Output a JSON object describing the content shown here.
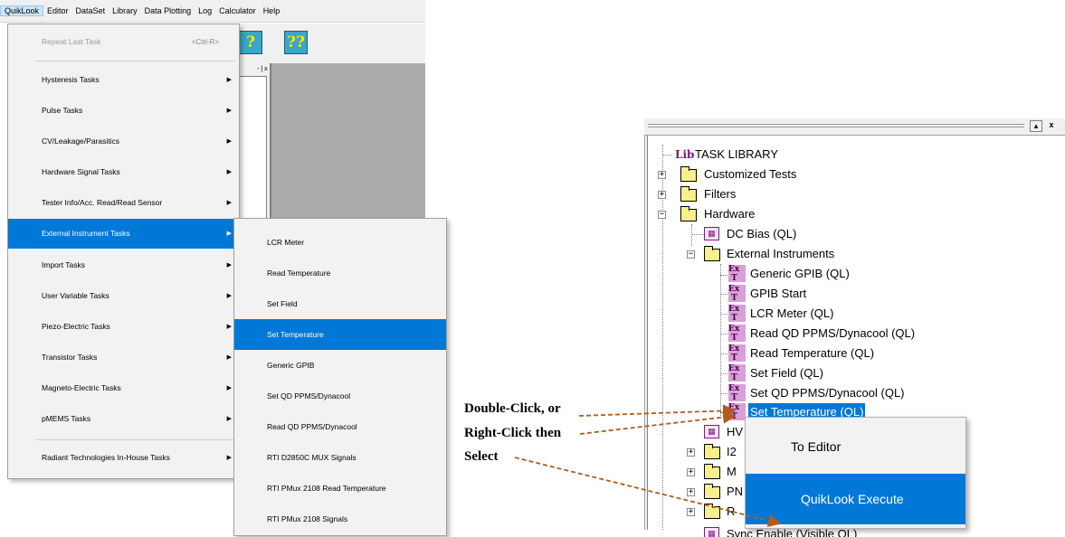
{
  "menubar": {
    "items": [
      "QuikLook",
      "Editor",
      "DataSet",
      "Library",
      "Data Plotting",
      "Log",
      "Calculator",
      "Help"
    ]
  },
  "toolbar": {
    "buttons": [
      "help-icon",
      "help-index-icon"
    ]
  },
  "quiklook_menu": {
    "items": [
      {
        "label": "Repeat Last Task",
        "shortcut": "<Ctrl-R>",
        "disabled": true
      },
      {
        "label": "Hysteresis Tasks"
      },
      {
        "label": "Pulse Tasks"
      },
      {
        "label": "CV/Leakage/Parasitics"
      },
      {
        "label": "Hardware Signal Tasks"
      },
      {
        "label": "Tester Info/Acc. Read/Read Sensor"
      },
      {
        "label": "External Instrument Tasks",
        "highlighted": true
      },
      {
        "label": "Import Tasks"
      },
      {
        "label": "User Variable Tasks"
      },
      {
        "label": "Piezo-Electric Tasks"
      },
      {
        "label": "Transistor Tasks"
      },
      {
        "label": "Magneto-Electric Tasks"
      },
      {
        "label": "pMEMS Tasks"
      },
      {
        "label": "Radiant Technologies In-House Tasks"
      }
    ]
  },
  "submenu": {
    "items": [
      "LCR Meter",
      "Read Temperature",
      "Set Field",
      "Set Temperature",
      "Generic GPIB",
      "Set QD PPMS/Dynacool",
      "Read QD PPMS/Dynacool",
      "RTI D2850C MUX Signals",
      "RTI PMux 2108 Read Temperature",
      "RTI PMux 2108 Signals"
    ],
    "highlighted": "Set Temperature"
  },
  "tree": {
    "root": "TASK LIBRARY",
    "root_icon": "Lib",
    "customized": "Customized Tests",
    "filters": "Filters",
    "hardware": "Hardware",
    "dc_bias": "DC Bias (QL)",
    "ext_instruments": "External Instruments",
    "ext_items": [
      "Generic GPIB (QL)",
      "GPIB Start",
      "LCR Meter (QL)",
      "Read QD PPMS/Dynacool (QL)",
      "Read Temperature (QL)",
      "Set Field (QL)",
      "Set QD PPMS/Dynacool (QL)",
      "Set Temperature (QL)"
    ],
    "partial": [
      "HV",
      "I2",
      "M",
      "PN",
      "R",
      "Sync Enable (Visible QL)"
    ]
  },
  "context_menu": {
    "to_editor": "To Editor",
    "execute": "QuikLook Execute"
  },
  "annotation": {
    "line1": "Double-Click, or",
    "line2": "Right-Click then",
    "line3": "Select"
  },
  "colors": {
    "highlight": "#0078d7",
    "arrow": "#b45a1e",
    "menu_bg": "#f2f2f2"
  }
}
